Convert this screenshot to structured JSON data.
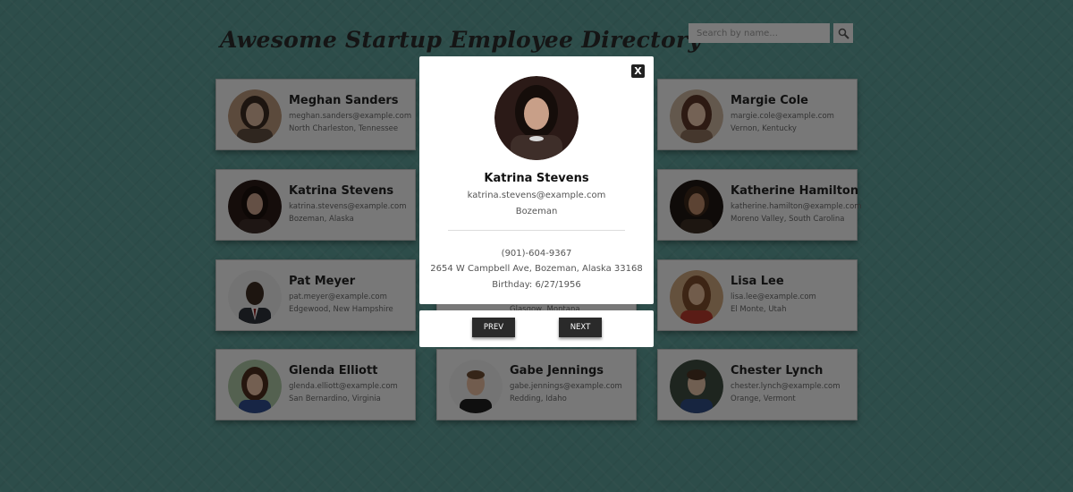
{
  "header": {
    "title": "Awesome Startup Employee Directory",
    "search": {
      "placeholder": "Search by name..."
    }
  },
  "cards": [
    {
      "name": "Meghan Sanders",
      "email": "meghan.sanders@example.com",
      "location": "North Charleston, Tennessee"
    },
    {
      "name": "",
      "email": "",
      "location": ""
    },
    {
      "name": "Margie Cole",
      "email": "margie.cole@example.com",
      "location": "Vernon, Kentucky"
    },
    {
      "name": "Katrina Stevens",
      "email": "katrina.stevens@example.com",
      "location": "Bozeman, Alaska"
    },
    {
      "name": "",
      "email": "",
      "location": ""
    },
    {
      "name": "Katherine Hamilton",
      "email": "katherine.hamilton@example.com",
      "location": "Moreno Valley, South Carolina"
    },
    {
      "name": "Pat Meyer",
      "email": "pat.meyer@example.com",
      "location": "Edgewood, New Hampshire"
    },
    {
      "name": "",
      "email": "",
      "location": "Glasgow, Montana"
    },
    {
      "name": "Lisa Lee",
      "email": "lisa.lee@example.com",
      "location": "El Monte, Utah"
    },
    {
      "name": "Glenda Elliott",
      "email": "glenda.elliott@example.com",
      "location": "San Bernardino, Virginia"
    },
    {
      "name": "Gabe Jennings",
      "email": "gabe.jennings@example.com",
      "location": "Redding, Idaho"
    },
    {
      "name": "Chester Lynch",
      "email": "chester.lynch@example.com",
      "location": "Orange, Vermont"
    }
  ],
  "modal": {
    "close_label": "X",
    "name": "Katrina Stevens",
    "email": "katrina.stevens@example.com",
    "city": "Bozeman",
    "phone": "(901)-604-9367",
    "address": "2654 W Campbell Ave, Bozeman, Alaska 33168",
    "birthday": "Birthday: 6/27/1956",
    "prev_label": "PREV",
    "next_label": "NEXT"
  }
}
